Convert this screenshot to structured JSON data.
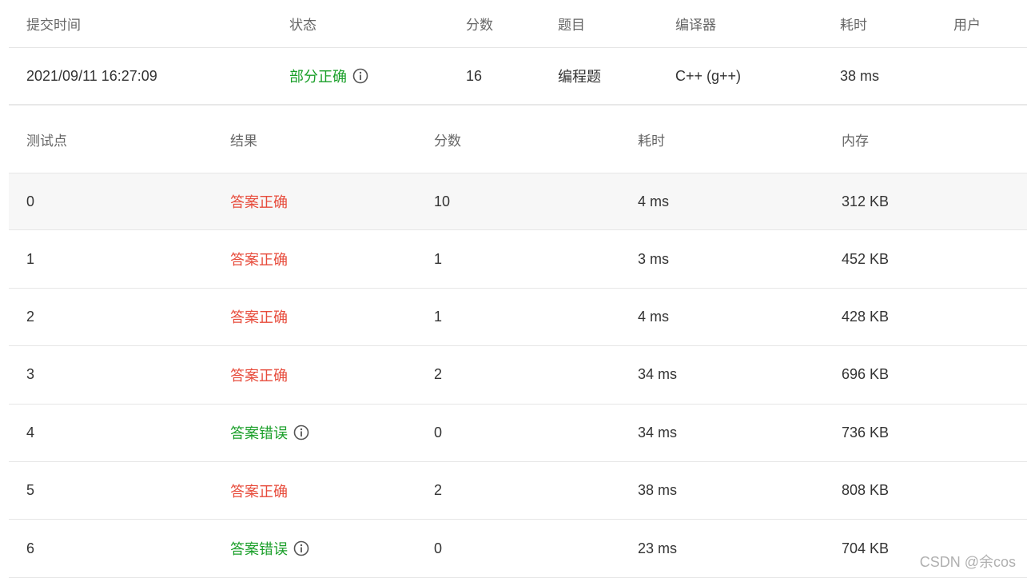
{
  "summary": {
    "headers": {
      "submit_time": "提交时间",
      "status": "状态",
      "score": "分数",
      "problem": "题目",
      "compiler": "编译器",
      "time": "耗时",
      "user": "用户"
    },
    "row": {
      "submit_time": "2021/09/11 16:27:09",
      "status": "部分正确",
      "score": "16",
      "problem": "编程题",
      "compiler": "C++ (g++)",
      "time": "38 ms",
      "user": ""
    }
  },
  "tests": {
    "headers": {
      "case": "测试点",
      "result": "结果",
      "score": "分数",
      "time": "耗时",
      "memory": "内存"
    },
    "rows": [
      {
        "case": "0",
        "result": "答案正确",
        "score": "10",
        "time": "4 ms",
        "memory": "312 KB"
      },
      {
        "case": "1",
        "result": "答案正确",
        "score": "1",
        "time": "3 ms",
        "memory": "452 KB"
      },
      {
        "case": "2",
        "result": "答案正确",
        "score": "1",
        "time": "4 ms",
        "memory": "428 KB"
      },
      {
        "case": "3",
        "result": "答案正确",
        "score": "2",
        "time": "34 ms",
        "memory": "696 KB"
      },
      {
        "case": "4",
        "result": "答案错误",
        "score": "0",
        "time": "34 ms",
        "memory": "736 KB"
      },
      {
        "case": "5",
        "result": "答案正确",
        "score": "2",
        "time": "38 ms",
        "memory": "808 KB"
      },
      {
        "case": "6",
        "result": "答案错误",
        "score": "0",
        "time": "23 ms",
        "memory": "704 KB"
      }
    ]
  },
  "colors": {
    "correct": "#e74c3c",
    "wrong": "#1a9f29",
    "partial": "#1a9f29"
  },
  "icons": {
    "info": "info-circle-icon"
  },
  "watermark": "CSDN @余cos"
}
